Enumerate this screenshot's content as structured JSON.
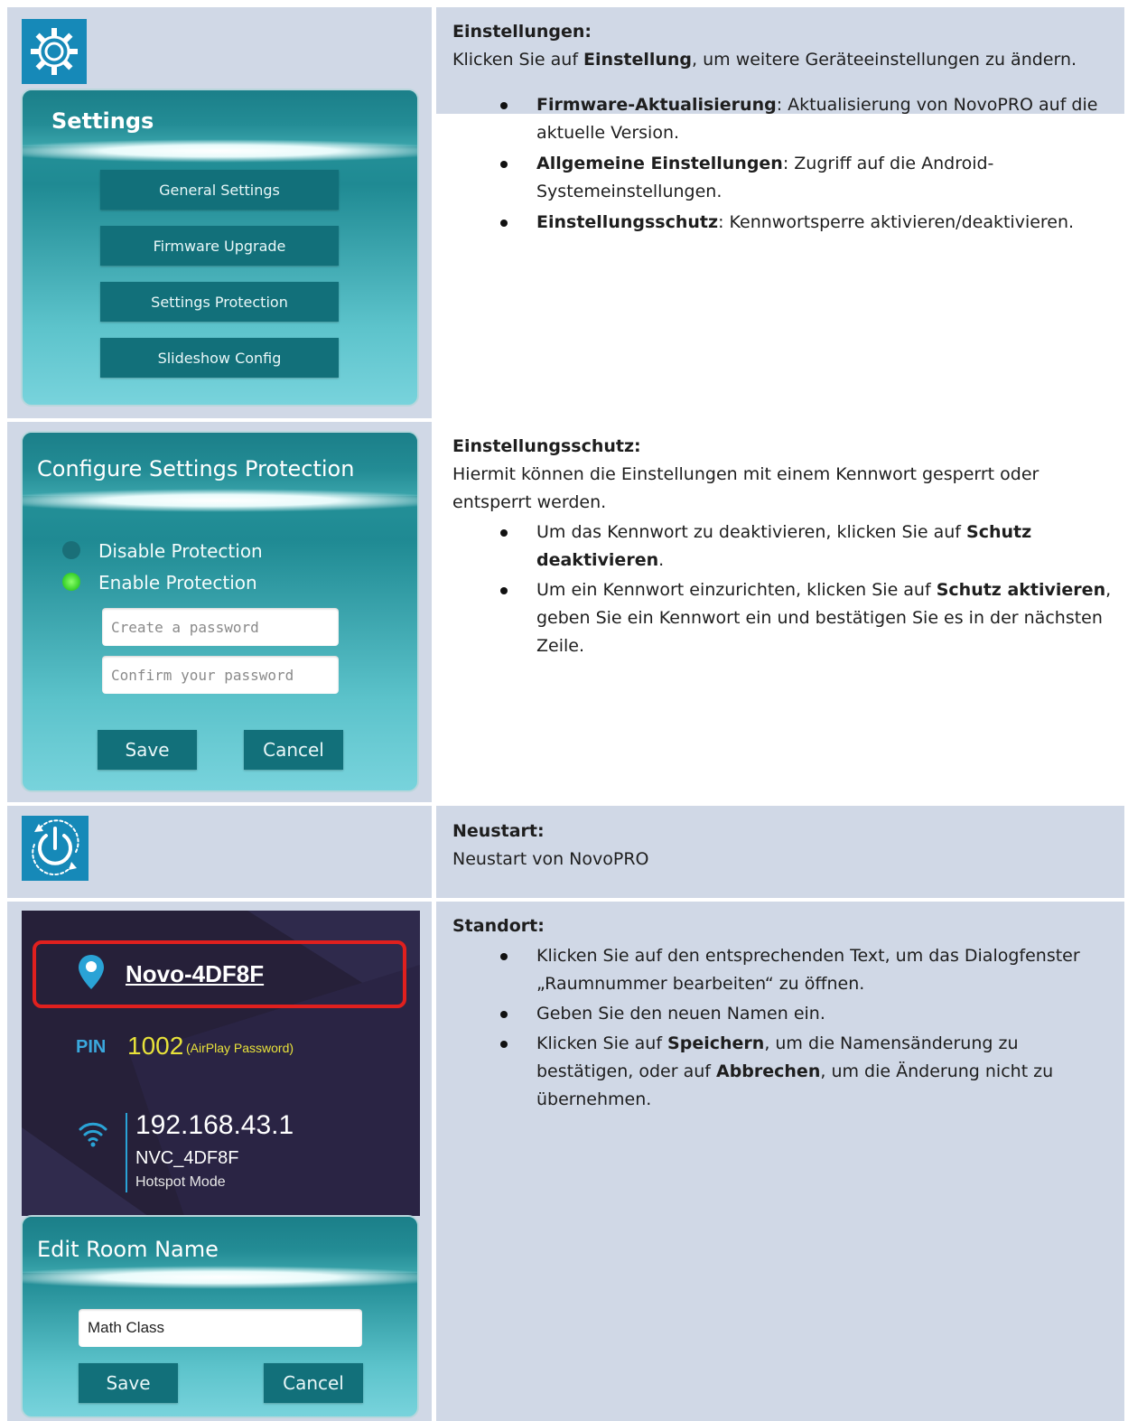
{
  "section_settings": {
    "heading": "Einstellungen:",
    "intro_pre": "Klicken Sie auf ",
    "intro_bold": "Einstellung",
    "intro_post": ", um weitere Geräteeinstellungen zu ändern.",
    "bullets": [
      {
        "bold": "Firmware-Aktualisierung",
        "text": ": Aktualisierung von NovoPRO auf die aktuelle Version."
      },
      {
        "bold": "Allgemeine Einstellungen",
        "text": ": Zugriff auf die Android-Systemeinstellungen."
      },
      {
        "bold": "Einstellungsschutz",
        "text": ": Kennwortsperre aktivieren/deaktivieren."
      }
    ],
    "dialog_title": "Settings",
    "menu": [
      "General Settings",
      "Firmware Upgrade",
      "Settings Protection",
      "Slideshow Config"
    ]
  },
  "section_protection": {
    "heading": "Einstellungsschutz:",
    "intro": "Hiermit können die Einstellungen mit einem Kennwort gesperrt oder entsperrt werden.",
    "bullet1_pre": "Um das Kennwort zu deaktivieren, klicken Sie auf ",
    "bullet1_bold": "Schutz deaktivieren",
    "bullet1_post": ".",
    "bullet2_pre": "Um ein Kennwort einzurichten, klicken Sie auf ",
    "bullet2_bold": "Schutz aktivieren",
    "bullet2_post": ", geben Sie ein Kennwort ein und bestätigen Sie es in der nächsten Zeile.",
    "dialog_title": "Configure Settings Protection",
    "disable_label": "Disable Protection",
    "enable_label": "Enable Protection",
    "password_placeholder": "Create a password",
    "confirm_placeholder": "Confirm your password",
    "save": "Save",
    "cancel": "Cancel"
  },
  "section_restart": {
    "heading": "Neustart:",
    "text": "Neustart von NovoPRO"
  },
  "section_location": {
    "heading": "Standort:",
    "bullet1": "Klicken Sie auf den entsprechenden Text, um das Dialogfenster „Raumnummer bearbeiten“ zu öffnen.",
    "bullet2": "Geben Sie den neuen Namen ein.",
    "bullet3_pre": "Klicken Sie auf ",
    "bullet3_bold1": "Speichern",
    "bullet3_mid": ", um die Namensänderung zu bestätigen, oder auf ",
    "bullet3_bold2": "Abbrechen",
    "bullet3_post": ", um die Änderung nicht zu übernehmen.",
    "room_name": "Novo-4DF8F",
    "pin_label": "PIN",
    "pin_value": "1002",
    "pin_note": "(AirPlay Password)",
    "ip": "192.168.43.1",
    "ssid": "NVC_4DF8F",
    "mode": "Hotspot Mode",
    "dialog_title": "Edit Room Name",
    "input_value": "Math Class",
    "save": "Save",
    "cancel": "Cancel"
  },
  "colors": {
    "cell_bg": "#d0d8e6",
    "teal_dark": "#12707a",
    "teal_light": "#78d3dc",
    "highlight_red": "#e0201e",
    "pin_yellow": "#e8e23a"
  }
}
